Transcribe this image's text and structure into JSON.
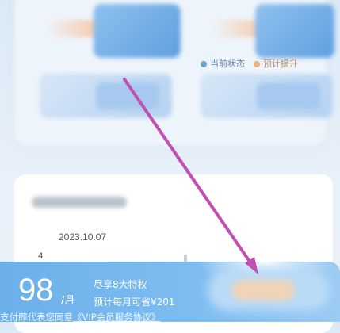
{
  "chart": {
    "date": "2023.10.07",
    "tick_value": "4",
    "legend_current": "当前状态",
    "legend_predicted": "预计提升"
  },
  "pay": {
    "price": "98",
    "unit": "/月",
    "perk_line_1": "尽享8大特权",
    "perk_line_2": "预计每月可省¥201",
    "agreement_prefix": "支付即代表您同意",
    "agreement_link": "《VIP会员服务协议》"
  },
  "colors": {
    "pay_bar": "#7dbcf0",
    "annotation_arrow": "#c24fb4"
  },
  "icons": [
    "annotation-arrow"
  ]
}
